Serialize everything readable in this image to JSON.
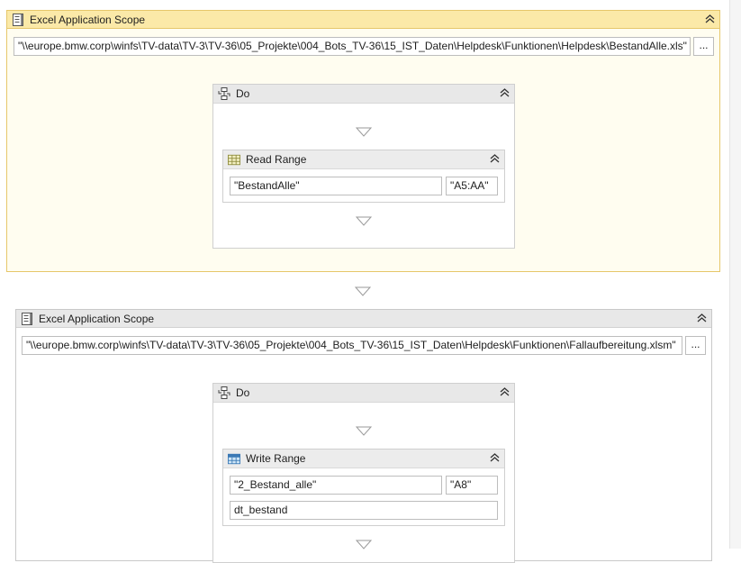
{
  "scopes": [
    {
      "title": "Excel Application Scope",
      "path": "\"\\\\europe.bmw.corp\\winfs\\TV-data\\TV-3\\TV-36\\05_Projekte\\004_Bots_TV-36\\15_IST_Daten\\Helpdesk\\Funktionen\\Helpdesk\\BestandAlle.xls\"",
      "browse_label": "...",
      "do_title": "Do",
      "activity": {
        "title": "Read Range",
        "sheet": "\"BestandAlle\"",
        "range": "\"A5:AA\""
      }
    },
    {
      "title": "Excel Application Scope",
      "path": "\"\\\\europe.bmw.corp\\winfs\\TV-data\\TV-3\\TV-36\\05_Projekte\\004_Bots_TV-36\\15_IST_Daten\\Helpdesk\\Funktionen\\Fallaufbereitung.xlsm\"",
      "browse_label": "...",
      "do_title": "Do",
      "activity": {
        "title": "Write Range",
        "sheet": "\"2_Bestand_alle\"",
        "range": "\"A8\"",
        "datatable": "dt_bestand"
      }
    }
  ],
  "icons": {
    "scope": "excel-book-icon",
    "do": "sequence-icon",
    "read": "read-range-icon",
    "write": "write-range-icon",
    "collapse": "double-chevron-up-icon",
    "drop": "drop-target-triangle-icon"
  },
  "colors": {
    "selected_header": "#fbe9a8",
    "selected_border": "#e6c76a",
    "header": "#e8e8e8"
  }
}
